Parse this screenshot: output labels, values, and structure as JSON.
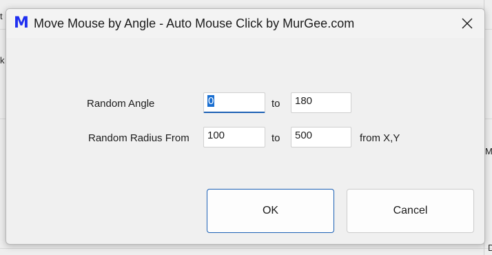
{
  "window": {
    "app_icon_glyph": "M",
    "title": "Move Mouse by Angle - Auto Mouse Click by MurGee.com",
    "accent_color": "#1f2ff0"
  },
  "form": {
    "angle": {
      "label": "Random Angle",
      "from_value": "0",
      "to_label": "to",
      "to_value": "180"
    },
    "radius": {
      "label": "Random Radius From",
      "from_value": "100",
      "to_label": "to",
      "to_value": "500",
      "suffix": "from X,Y"
    }
  },
  "buttons": {
    "ok_label": "OK",
    "cancel_label": "Cancel"
  },
  "background": {
    "fragment_top_left": "t",
    "fragment_mid_left": "k",
    "fragment_right": "M",
    "fragment_bottom_right": "D"
  }
}
